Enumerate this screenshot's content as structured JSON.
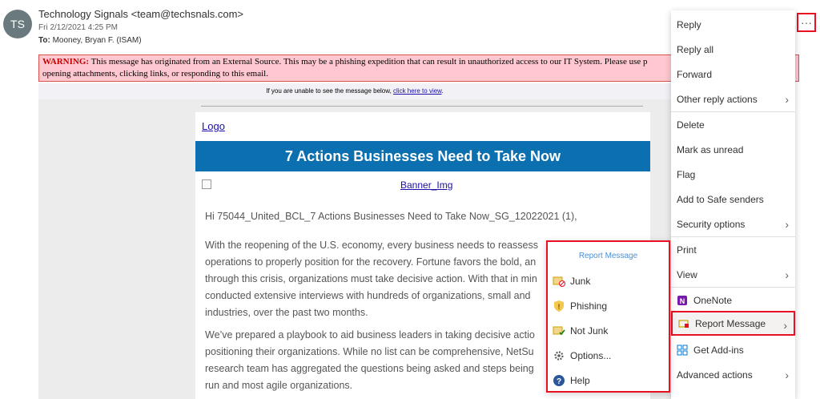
{
  "header": {
    "avatar_initials": "TS",
    "sender": "Technology Signals <team@techsnals.com>",
    "date": "Fri 2/12/2021 4:25 PM",
    "to_label": "To:",
    "to_value": "Mooney, Bryan F. (ISAM)",
    "more_icon": "···"
  },
  "warning": {
    "label": "WARNING:",
    "text": "This message has originated from an External Source. This may be a phishing expedition that can result in unauthorized access to our IT System. Please use p",
    "text2": "opening attachments, clicking links, or responding to this email."
  },
  "view_bar": {
    "text": "If you are unable to see the message below, ",
    "link": "click here to view",
    "end": "."
  },
  "email": {
    "logo_alt": "Logo",
    "banner_title": "7 Actions Businesses Need to Take Now",
    "banner_img_alt": "Banner_Img",
    "greeting": "Hi 75044_United_BCL_7 Actions Businesses Need to Take Now_SG_12022021 (1),",
    "para1_lines": [
      "With the reopening of the U.S. economy, every business needs to reassess",
      "operations to properly position for the recovery. Fortune favors the bold, an",
      "through this crisis, organizations must take decisive action. With that in min",
      "conducted extensive interviews with hundreds of organizations, small and",
      "industries, over the past two months."
    ],
    "para2_lines": [
      "We’ve prepared a playbook to aid business leaders in taking decisive actio",
      "positioning their organizations. While no list can be comprehensive, NetSu",
      "research team has aggregated the questions being asked and steps being",
      "run and most agile organizations."
    ]
  },
  "menu": {
    "items": [
      {
        "label": "Reply"
      },
      {
        "label": "Reply all"
      },
      {
        "label": "Forward"
      },
      {
        "label": "Other reply actions"
      },
      {
        "label": "Delete"
      },
      {
        "label": "Mark as unread"
      },
      {
        "label": "Flag"
      },
      {
        "label": "Add to Safe senders"
      },
      {
        "label": "Security options"
      },
      {
        "label": "Print"
      },
      {
        "label": "View"
      },
      {
        "label": "OneNote"
      },
      {
        "label": "Report Message"
      },
      {
        "label": "Get Add-ins"
      },
      {
        "label": "Advanced actions"
      }
    ]
  },
  "submenu": {
    "title": "Report Message",
    "items": [
      {
        "label": "Junk"
      },
      {
        "label": "Phishing"
      },
      {
        "label": "Not Junk"
      },
      {
        "label": "Options..."
      },
      {
        "label": "Help"
      }
    ]
  },
  "colors": {
    "accent_red": "#e81123",
    "banner_blue": "#0b6fb0",
    "warning_bg": "#ffc8d0"
  }
}
